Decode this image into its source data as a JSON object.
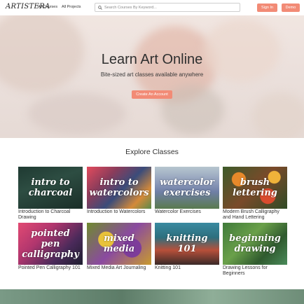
{
  "header": {
    "logo": "ARTISTERA",
    "nav": [
      "All Courses",
      "All Projects"
    ],
    "search_placeholder": "Search Courses By Keyword...",
    "signin_label": "Sign In",
    "demo_label": "Demo",
    "accent": "#f28b76"
  },
  "hero": {
    "title": "Learn Art Online",
    "subtitle": "Bite-sized art classes available anywhere",
    "cta_label": "Create An Account"
  },
  "explore": {
    "title": "Explore Classes",
    "courses": [
      {
        "thumb_text": "intro to charcoal",
        "title": "Introduction to Charcoal Drawing"
      },
      {
        "thumb_text": "intro to watercolors",
        "title": "Introduction to Watercolors"
      },
      {
        "thumb_text": "watercolor exercises",
        "title": "Watercolor Exercises"
      },
      {
        "thumb_text": "brush lettering",
        "title": "Modern Brush Calligraphy and Hand Lettering"
      },
      {
        "thumb_text": "pointed pen calligraphy",
        "title": "Pointed Pen Calligraphy 101"
      },
      {
        "thumb_text": "mixed media",
        "title": "Mixed Media Art Journaling"
      },
      {
        "thumb_text": "knitting 101",
        "title": "Knitting 101"
      },
      {
        "thumb_text": "beginning drawing",
        "title": "Drawing Lessons for Beginners"
      }
    ]
  }
}
